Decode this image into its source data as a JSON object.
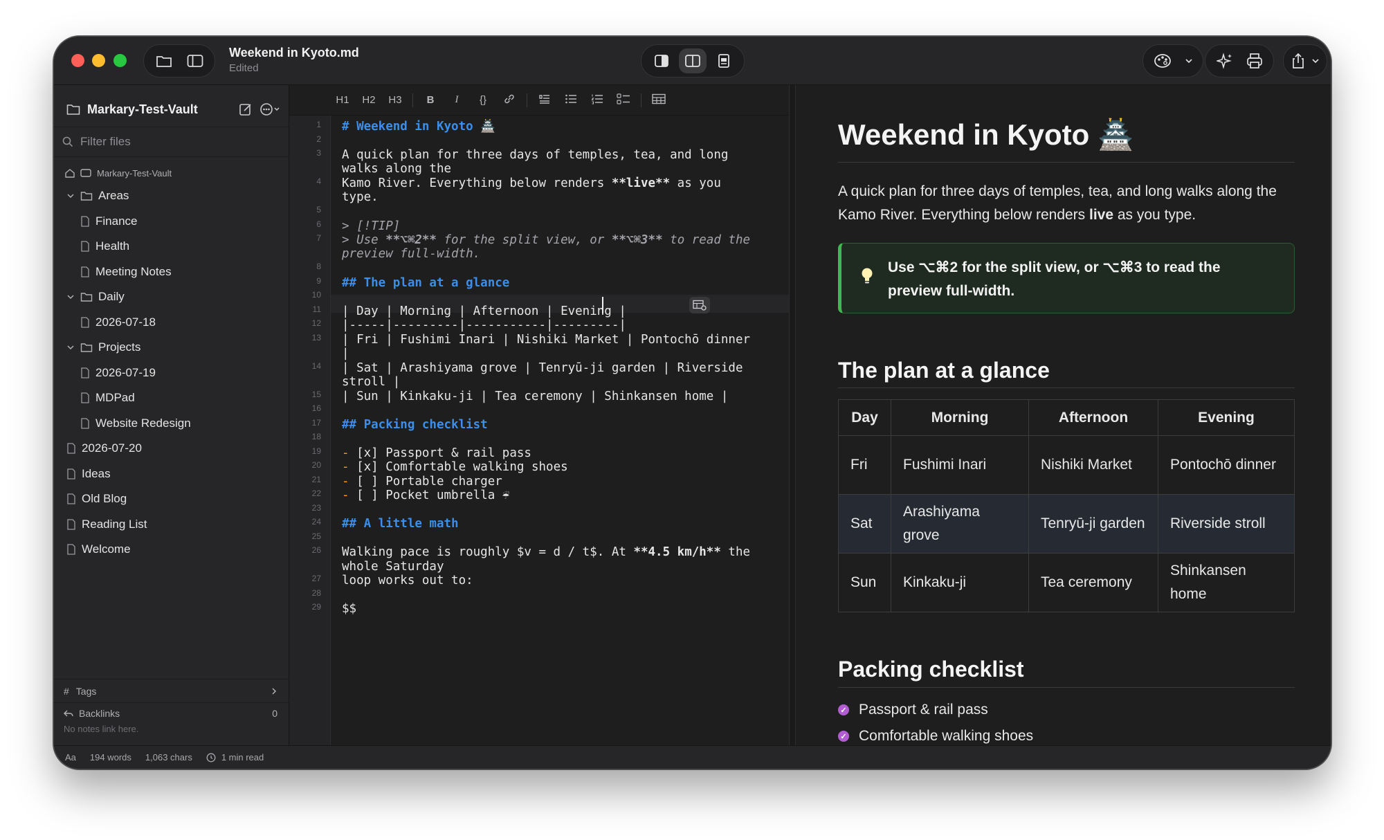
{
  "titlebar": {
    "doc_title": "Weekend in Kyoto.md",
    "doc_status": "Edited"
  },
  "sidebar": {
    "vault_name": "Markary-Test-Vault",
    "filter_placeholder": "Filter files",
    "root_label": "Markary-Test-Vault",
    "tree": [
      {
        "label": "Areas",
        "type": "folder",
        "depth": 0
      },
      {
        "label": "Finance",
        "type": "file",
        "depth": 1
      },
      {
        "label": "Health",
        "type": "file",
        "depth": 1
      },
      {
        "label": "Meeting Notes",
        "type": "file",
        "depth": 1
      },
      {
        "label": "Daily",
        "type": "folder",
        "depth": 0
      },
      {
        "label": "2026-07-18",
        "type": "file",
        "depth": 1
      },
      {
        "label": "Projects",
        "type": "folder",
        "depth": 0
      },
      {
        "label": "2026-07-19",
        "type": "file",
        "depth": 1
      },
      {
        "label": "MDPad",
        "type": "file",
        "depth": 1
      },
      {
        "label": "Website Redesign",
        "type": "file",
        "depth": 1
      },
      {
        "label": "2026-07-20",
        "type": "file",
        "depth": 0
      },
      {
        "label": "Ideas",
        "type": "file",
        "depth": 0
      },
      {
        "label": "Old Blog",
        "type": "file",
        "depth": 0
      },
      {
        "label": "Reading List",
        "type": "file",
        "depth": 0
      },
      {
        "label": "Welcome",
        "type": "file",
        "depth": 0
      }
    ],
    "tags_label": "Tags",
    "backlinks_label": "Backlinks",
    "backlinks_count": "0",
    "backlinks_empty": "No notes link here."
  },
  "toolbar": {
    "h1": "H1",
    "h2": "H2",
    "h3": "H3",
    "bold": "B",
    "italic": "I",
    "code": "{}"
  },
  "editor": {
    "line_numbers": [
      "1",
      "2",
      "3",
      "4",
      "5",
      "6",
      "7",
      "8",
      "9",
      "10",
      "11",
      "12",
      "13",
      "14",
      "15",
      "16",
      "17",
      "18",
      "19",
      "20",
      "21",
      "22",
      "23",
      "24",
      "25",
      "26",
      "27",
      "28",
      "29"
    ],
    "lines": {
      "l1": "# Weekend in Kyoto 🏯",
      "l3a": "A quick plan for three days of temples, tea, and long",
      "l3b": "walks along the",
      "l4a_pre": "Kamo River. Everything below renders ",
      "l4a_bold": "**live**",
      "l4a_post": " as you",
      "l4b": "type.",
      "l6": "> [!TIP]",
      "l7a_pre": "> Use ",
      "l7a_b1": "**⌥⌘2**",
      "l7a_mid": " for the split view, or ",
      "l7a_b2": "**⌥⌘3**",
      "l7a_post": " to read the",
      "l7b": "preview full-width.",
      "l9": "## The plan at a glance",
      "l11": "| Day | Morning | Afternoon | Evening |",
      "l12": "|-----|---------|-----------|---------|",
      "l13a": "| Fri | Fushimi Inari | Nishiki Market | Pontochō dinner",
      "l13b": "|",
      "l14a": "| Sat | Arashiyama grove | Tenryū-ji garden | Riverside",
      "l14b": "stroll |",
      "l15": "| Sun | Kinkaku-ji | Tea ceremony | Shinkansen home |",
      "l17": "## Packing checklist",
      "l19": "[x] Passport & rail pass",
      "l20": "[x] Comfortable walking shoes",
      "l21": "[ ] Portable charger",
      "l22": "[ ] Pocket umbrella ☔",
      "l24": "## A little math",
      "l26a_pre": "Walking pace is roughly $v = d / t$. At ",
      "l26a_bold": "**4.5 km/h**",
      "l26a_post": " the",
      "l26b": "whole Saturday",
      "l27": "loop works out to:",
      "l29": "$$",
      "dash": "-"
    }
  },
  "preview": {
    "h1": "Weekend in Kyoto 🏯",
    "intro_pre": "A quick plan for three days of temples, tea, and long walks along the Kamo River. Everything below renders ",
    "intro_bold": "live",
    "intro_post": " as you type.",
    "tip": "Use ⌥⌘2 for the split view, or ⌥⌘3 to read the preview full-width.",
    "h2_plan": "The plan at a glance",
    "table": {
      "headers": [
        "Day",
        "Morning",
        "Afternoon",
        "Evening"
      ],
      "rows": [
        [
          "Fri",
          "Fushimi Inari",
          "Nishiki Market",
          "Pontochō dinner"
        ],
        [
          "Sat",
          "Arashiyama grove",
          "Tenryū-ji garden",
          "Riverside stroll"
        ],
        [
          "Sun",
          "Kinkaku-ji",
          "Tea ceremony",
          "Shinkansen home"
        ]
      ]
    },
    "h2_packing": "Packing checklist",
    "checklist": [
      "Passport & rail pass",
      "Comfortable walking shoes"
    ]
  },
  "statusbar": {
    "font_label": "Aa",
    "words": "194 words",
    "chars": "1,063 chars",
    "read_time": "1 min read"
  },
  "colors": {
    "heading_blue": "#3b8eea",
    "list_dash": "#ff9f0a",
    "tip_green": "#3fb950",
    "checkbox_purple": "#b15dd1"
  }
}
